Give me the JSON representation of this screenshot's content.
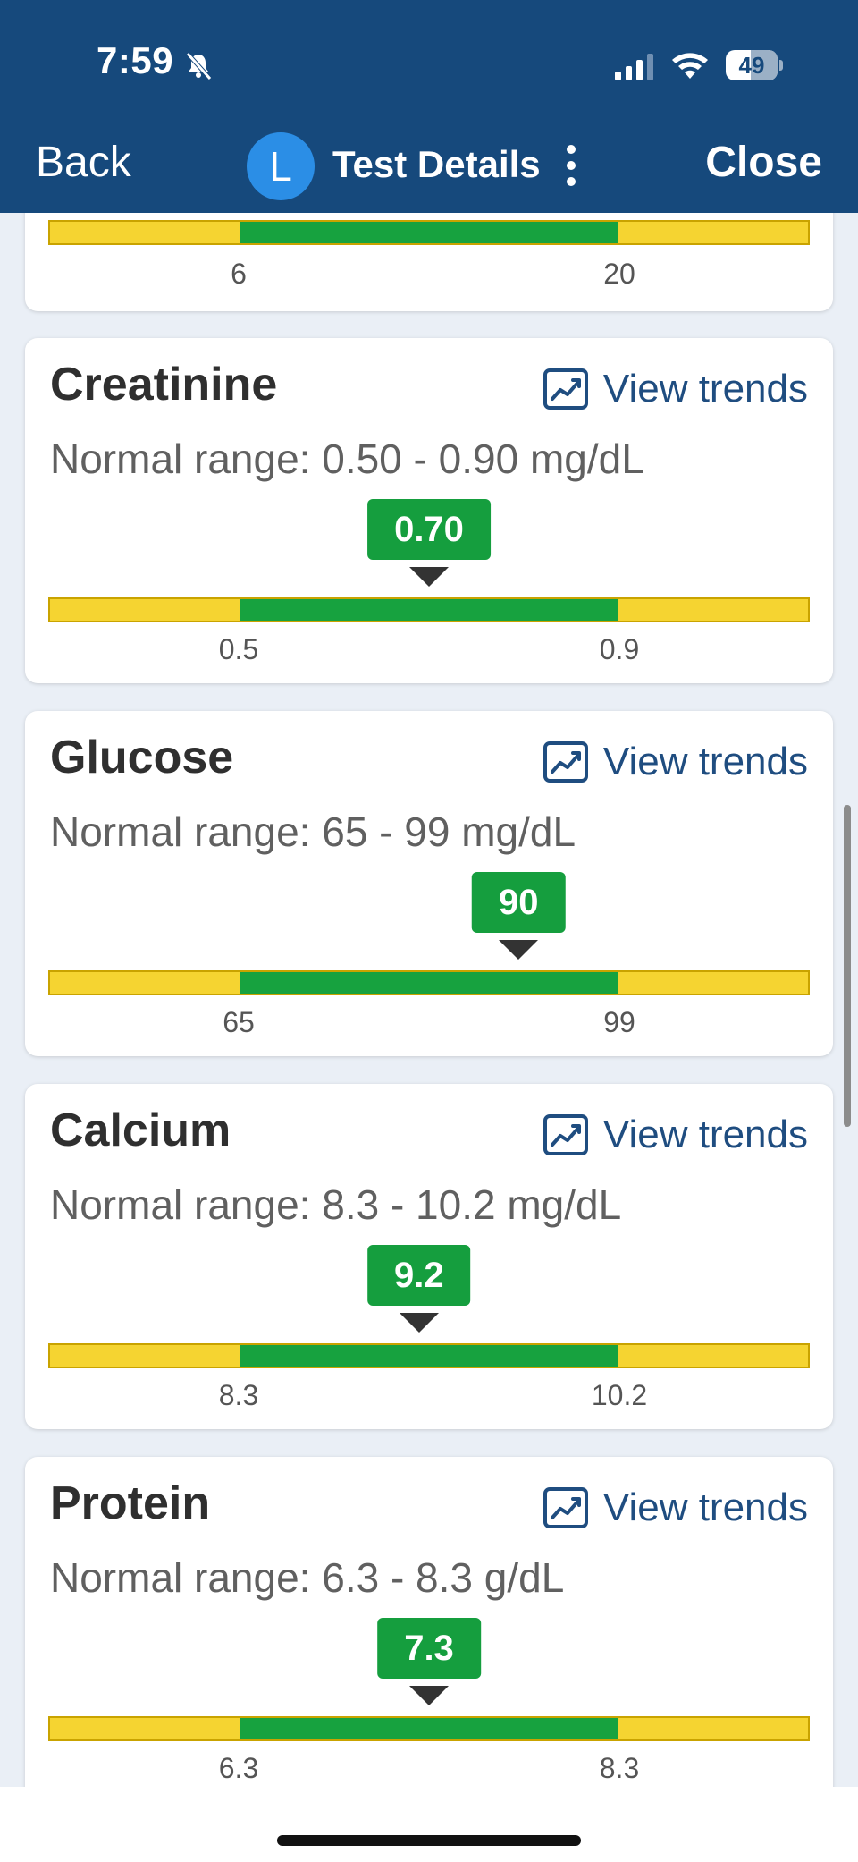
{
  "status_bar": {
    "time": "7:59",
    "battery_level": "49",
    "battery_fraction": 0.49
  },
  "nav": {
    "back_label": "Back",
    "avatar_initial": "L",
    "title": "Test Details",
    "close_label": "Close"
  },
  "top_partial": {
    "low_tick": "6",
    "high_tick": "20"
  },
  "tests": [
    {
      "name": "Creatinine",
      "trend_label": "View trends",
      "range_text": "Normal range: 0.50 - 0.90 mg/dL",
      "value_label": "0.70",
      "value": 0.7,
      "low": 0.5,
      "high": 0.9,
      "low_tick": "0.5",
      "high_tick": "0.9"
    },
    {
      "name": "Glucose",
      "trend_label": "View trends",
      "range_text": "Normal range: 65 - 99 mg/dL",
      "value_label": "90",
      "value": 90,
      "low": 65,
      "high": 99,
      "low_tick": "65",
      "high_tick": "99"
    },
    {
      "name": "Calcium",
      "trend_label": "View trends",
      "range_text": "Normal range: 8.3 - 10.2 mg/dL",
      "value_label": "9.2",
      "value": 9.2,
      "low": 8.3,
      "high": 10.2,
      "low_tick": "8.3",
      "high_tick": "10.2"
    },
    {
      "name": "Protein",
      "trend_label": "View trends",
      "range_text": "Normal range: 6.3 - 8.3 g/dL",
      "value_label": "7.3",
      "value": 7.3,
      "low": 6.3,
      "high": 8.3,
      "low_tick": "6.3",
      "high_tick": "8.3"
    }
  ],
  "colors": {
    "header": "#16497c",
    "in_range": "#17a23f",
    "out_of_range": "#f5d431",
    "badge": "#159e3e",
    "link": "#1f4d80"
  },
  "icons": {
    "trend": "trend-chart-icon",
    "more": "vertical-dots-icon",
    "bell": "bell-slash-icon"
  }
}
